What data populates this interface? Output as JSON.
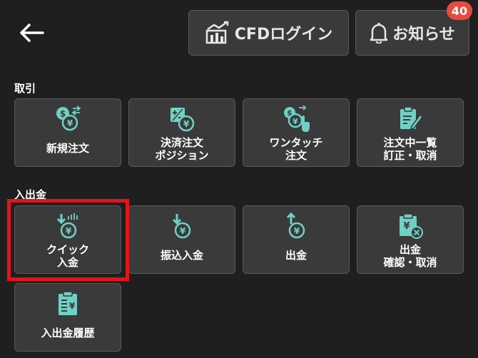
{
  "header": {
    "back_icon": "arrow-left-icon",
    "cfd_login_label": "CFDログイン",
    "notice_label": "お知らせ",
    "notice_badge_count": "40"
  },
  "sections": {
    "trade_label": "取引",
    "deposit_label": "入出金"
  },
  "trade_tiles": [
    {
      "label": "新規注文",
      "icon": "yen-dollar-exchange-icon"
    },
    {
      "label": "決済注文\nポジション",
      "icon": "plus-minus-settle-icon"
    },
    {
      "label": "ワンタッチ\n注文",
      "icon": "one-touch-tap-icon"
    },
    {
      "label": "注文中一覧\n訂正・取消",
      "icon": "order-list-edit-icon"
    }
  ],
  "deposit_tiles": [
    {
      "label": "クイック\n入金",
      "icon": "quick-deposit-icon"
    },
    {
      "label": "振込入金",
      "icon": "transfer-deposit-icon"
    },
    {
      "label": "出金",
      "icon": "withdraw-icon"
    },
    {
      "label": "出金\n確認・取消",
      "icon": "withdraw-cancel-icon"
    },
    {
      "label": "入出金履歴",
      "icon": "deposit-history-icon"
    }
  ],
  "colors": {
    "background": "#1f1f1f",
    "tile": "#3a3a3a",
    "icon_accent": "#6fd1c6",
    "badge": "#e84a3c",
    "highlight": "#e8121a"
  }
}
